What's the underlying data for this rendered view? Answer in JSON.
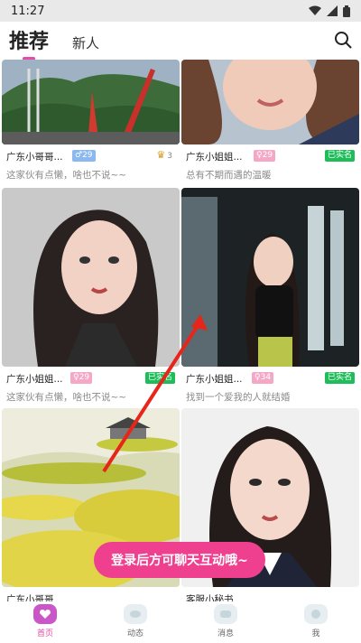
{
  "status": {
    "time": "11:27"
  },
  "nav": {
    "active_tab": "推荐",
    "tab2": "新人"
  },
  "cards": [
    {
      "name": "广东小哥哥...",
      "age": "♂29",
      "crown_count": "3",
      "verified": "",
      "bio": "这家伙有点懒，啥也不说~~"
    },
    {
      "name": "广东小姐姐...",
      "age": "♀29",
      "verified": "已实名",
      "bio": "总有不期而遇的温暖"
    },
    {
      "name": "广东小姐姐...",
      "age": "♀29",
      "verified": "已实名",
      "bio": "这家伙有点懒，啥也不说~~"
    },
    {
      "name": "广东小姐姐...",
      "age": "♀34",
      "verified": "已实名",
      "bio": "找到一个爱我的人就结婚"
    },
    {
      "name": "广东小哥哥",
      "age": "",
      "verified": "",
      "bio": ""
    },
    {
      "name": "客服小秘书",
      "age": "",
      "verified": "",
      "bio": ""
    }
  ],
  "login_prompt": "登录后方可聊天互动哦~",
  "bottom_nav": {
    "home": "首页",
    "moments": "动态",
    "messages": "消息",
    "me": "我"
  },
  "colors": {
    "accent": "#e94aa6",
    "pill": "#ef3f8f",
    "verified": "#1fbd5a"
  }
}
